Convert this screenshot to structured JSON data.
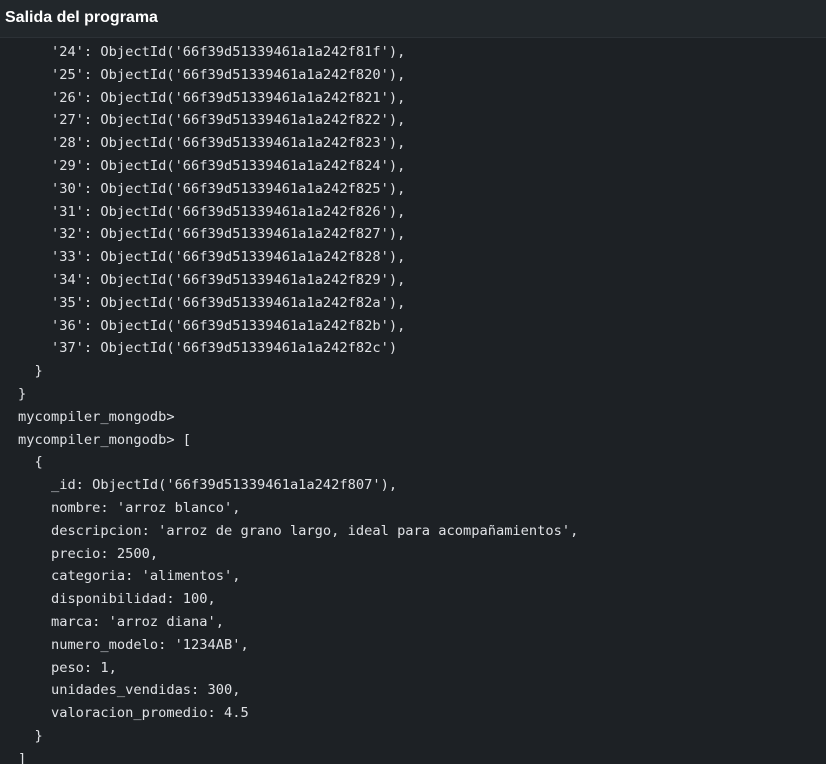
{
  "header": {
    "title": "Salida del programa"
  },
  "output": {
    "lines": [
      "    '24': ObjectId('66f39d51339461a1a242f81f'),",
      "    '25': ObjectId('66f39d51339461a1a242f820'),",
      "    '26': ObjectId('66f39d51339461a1a242f821'),",
      "    '27': ObjectId('66f39d51339461a1a242f822'),",
      "    '28': ObjectId('66f39d51339461a1a242f823'),",
      "    '29': ObjectId('66f39d51339461a1a242f824'),",
      "    '30': ObjectId('66f39d51339461a1a242f825'),",
      "    '31': ObjectId('66f39d51339461a1a242f826'),",
      "    '32': ObjectId('66f39d51339461a1a242f827'),",
      "    '33': ObjectId('66f39d51339461a1a242f828'),",
      "    '34': ObjectId('66f39d51339461a1a242f829'),",
      "    '35': ObjectId('66f39d51339461a1a242f82a'),",
      "    '36': ObjectId('66f39d51339461a1a242f82b'),",
      "    '37': ObjectId('66f39d51339461a1a242f82c')",
      "  }",
      "}",
      "mycompiler_mongodb>",
      "mycompiler_mongodb> [",
      "  {",
      "    _id: ObjectId('66f39d51339461a1a242f807'),",
      "    nombre: 'arroz blanco',",
      "    descripcion: 'arroz de grano largo, ideal para acompañamientos',",
      "    precio: 2500,",
      "    categoria: 'alimentos',",
      "    disponibilidad: 100,",
      "    marca: 'arroz diana',",
      "    numero_modelo: '1234AB',",
      "    peso: 1,",
      "    unidades_vendidas: 300,",
      "    valoracion_promedio: 4.5",
      "  }",
      "]"
    ]
  }
}
